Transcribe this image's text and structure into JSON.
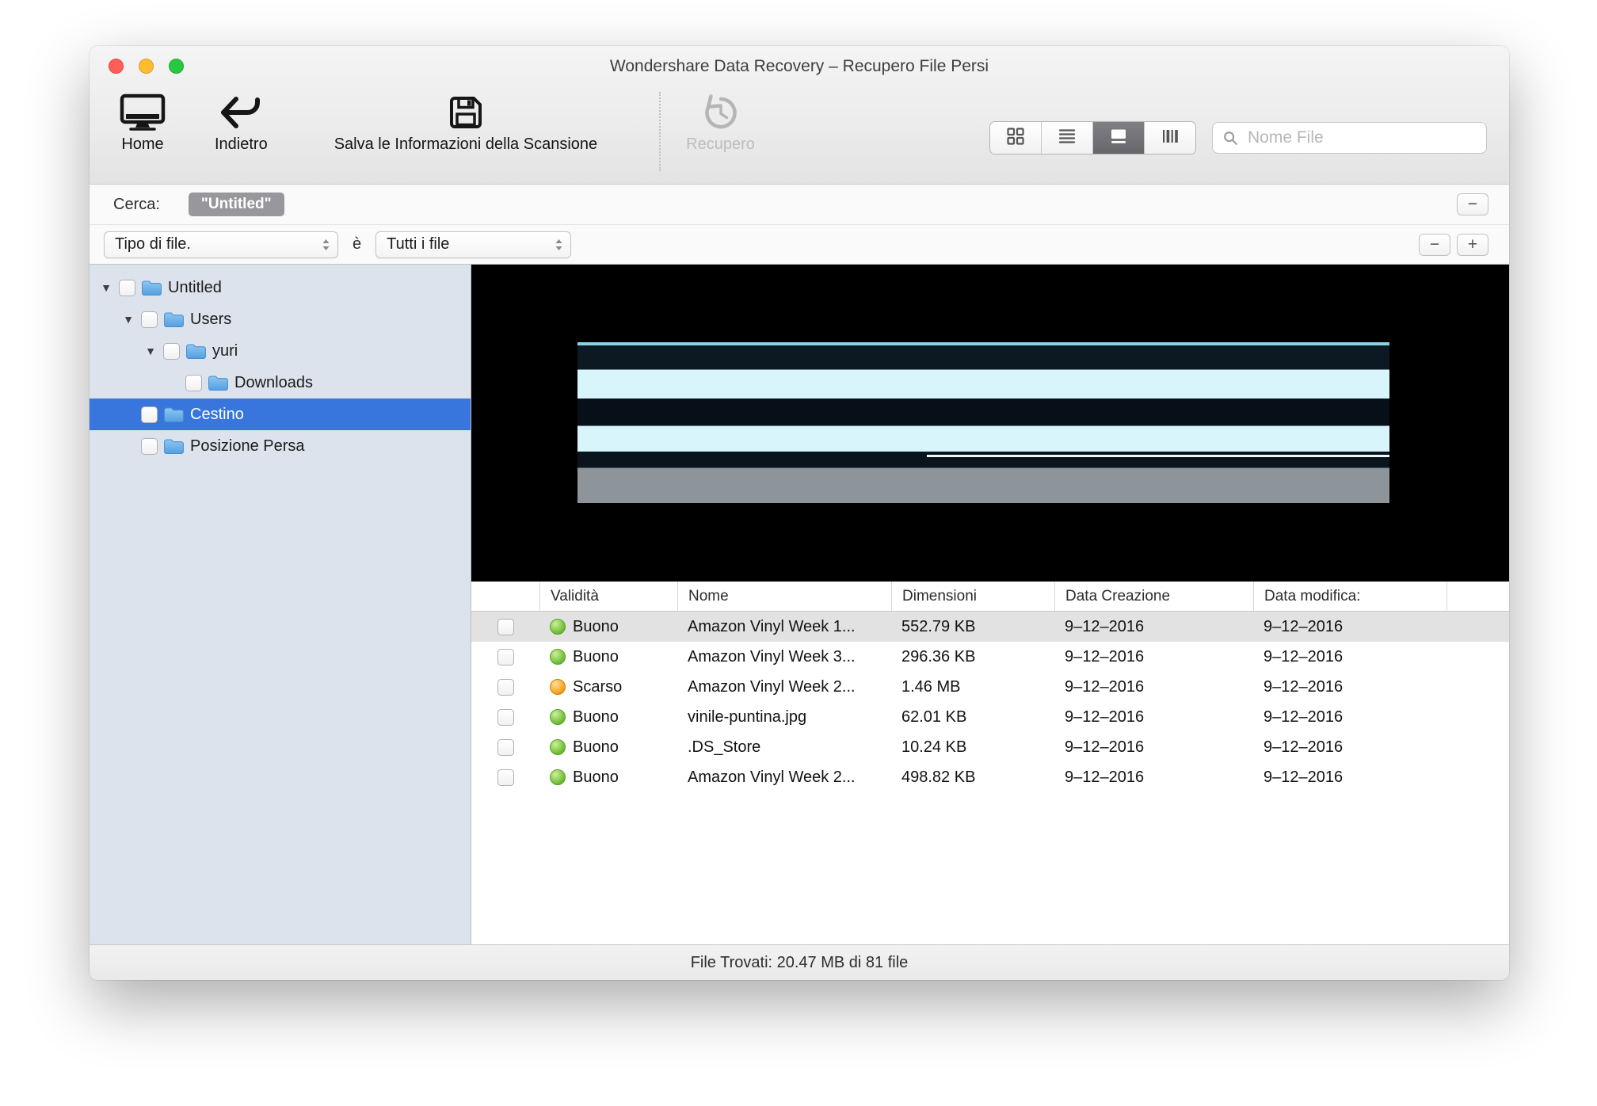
{
  "window": {
    "title": "Wondershare Data Recovery – Recupero File Persi"
  },
  "toolbar": {
    "home_label": "Home",
    "back_label": "Indietro",
    "save_label": "Salva le Informazioni della Scansione",
    "recover_label": "Recupero",
    "view_modes": [
      "grid-view",
      "list-view",
      "preview-view",
      "column-view"
    ],
    "active_view": 2,
    "search_placeholder": "Nome File"
  },
  "search_bar": {
    "label": "Cerca:",
    "token": "\"Untitled\"",
    "remove_label": "−"
  },
  "filter_bar": {
    "type_value": "Tipo di file.",
    "connector": "è",
    "kind_value": "Tutti i file",
    "remove_label": "−",
    "add_label": "+"
  },
  "sidebar": {
    "items": [
      {
        "label": "Untitled",
        "level": 0,
        "expandable": true,
        "selected": false
      },
      {
        "label": "Users",
        "level": 1,
        "expandable": true,
        "selected": false
      },
      {
        "label": "yuri",
        "level": 2,
        "expandable": true,
        "selected": false
      },
      {
        "label": "Downloads",
        "level": 3,
        "expandable": false,
        "selected": false
      },
      {
        "label": "Cestino",
        "level": 1,
        "expandable": false,
        "selected": true
      },
      {
        "label": "Posizione Persa",
        "level": 1,
        "expandable": false,
        "selected": false
      }
    ]
  },
  "table": {
    "columns": [
      "Validità",
      "Nome",
      "Dimensioni",
      "Data Creazione",
      "Data modifica:"
    ],
    "rows": [
      {
        "validity": "Buono",
        "status": "good",
        "name": "Amazon Vinyl Week 1...",
        "size": "552.79 KB",
        "created": "9–12–2016",
        "modified": "9–12–2016",
        "selected": true
      },
      {
        "validity": "Buono",
        "status": "good",
        "name": "Amazon Vinyl Week 3...",
        "size": "296.36 KB",
        "created": "9–12–2016",
        "modified": "9–12–2016",
        "selected": false
      },
      {
        "validity": "Scarso",
        "status": "poor",
        "name": "Amazon Vinyl Week 2...",
        "size": "1.46 MB",
        "created": "9–12–2016",
        "modified": "9–12–2016",
        "selected": false
      },
      {
        "validity": "Buono",
        "status": "good",
        "name": "vinile-puntina.jpg",
        "size": "62.01 KB",
        "created": "9–12–2016",
        "modified": "9–12–2016",
        "selected": false
      },
      {
        "validity": "Buono",
        "status": "good",
        "name": ".DS_Store",
        "size": "10.24 KB",
        "created": "9–12–2016",
        "modified": "9–12–2016",
        "selected": false
      },
      {
        "validity": "Buono",
        "status": "good",
        "name": "Amazon Vinyl Week 2...",
        "size": "498.82 KB",
        "created": "9–12–2016",
        "modified": "9–12–2016",
        "selected": false
      }
    ]
  },
  "status_bar": {
    "text": "File Trovati: 20.47 MB di 81 file"
  },
  "colors": {
    "selection": "#3875dd",
    "status_good": "#6fbf3e",
    "status_poor": "#f5a31f",
    "traffic_red": "#ff5f57",
    "traffic_yellow": "#febc2e",
    "traffic_green": "#28c840"
  }
}
